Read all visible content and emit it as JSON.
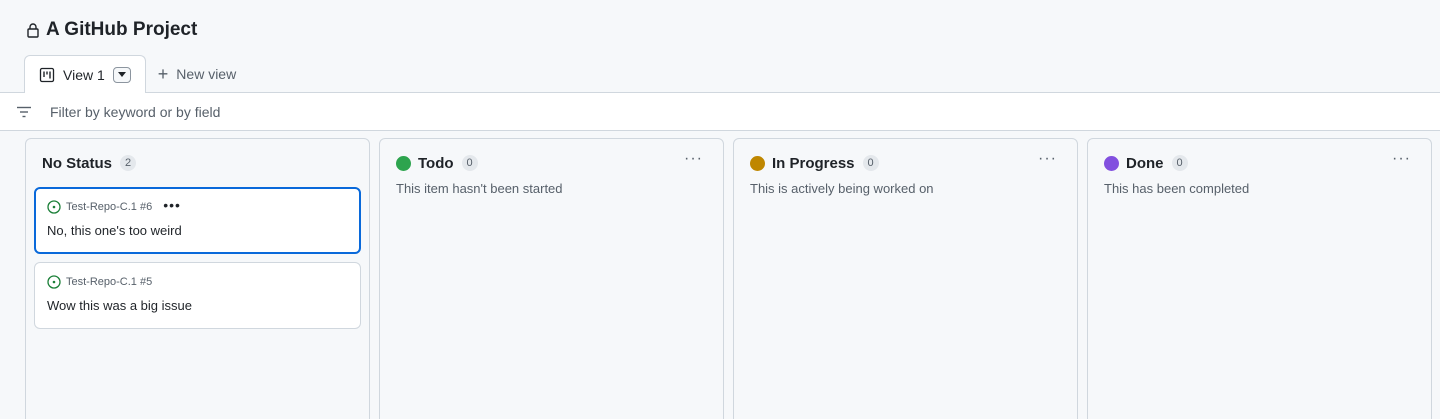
{
  "project": {
    "title": "A GitHub Project"
  },
  "tabs": {
    "view1": "View 1",
    "new_view": "New view"
  },
  "filter": {
    "placeholder": "Filter by keyword or by field"
  },
  "columns": [
    {
      "name": "No Status",
      "count": "2",
      "description": "",
      "color": ""
    },
    {
      "name": "Todo",
      "count": "0",
      "description": "This item hasn't been started",
      "color": "#2da44e"
    },
    {
      "name": "In Progress",
      "count": "0",
      "description": "This is actively being worked on",
      "color": "#bf8700"
    },
    {
      "name": "Done",
      "count": "0",
      "description": "This has been completed",
      "color": "#8250df"
    }
  ],
  "cards": [
    {
      "repo": "Test-Repo-C.1 #6",
      "title": "No, this one's too weird"
    },
    {
      "repo": "Test-Repo-C.1 #5",
      "title": "Wow this was a big issue"
    }
  ],
  "colors": {
    "accent": "#0969da",
    "open_issue": "#1a7f37"
  },
  "icons": {
    "lock": "lock-icon",
    "board": "project-board-icon",
    "caret": "triangle-down-icon",
    "plus": "plus-icon",
    "filter": "filter-icon",
    "more": "kebab-horizontal-icon",
    "issue": "issue-opened-icon"
  }
}
